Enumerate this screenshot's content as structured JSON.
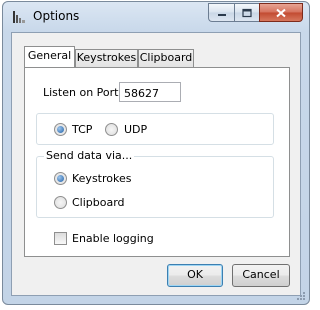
{
  "window": {
    "title": "Options",
    "controls": {
      "minimize": "minimize",
      "maximize": "maximize",
      "close": "close"
    }
  },
  "tabs": [
    {
      "label": "General",
      "active": true
    },
    {
      "label": "Keystrokes",
      "active": false
    },
    {
      "label": "Clipboard",
      "active": false
    }
  ],
  "general": {
    "port_label": "Listen on Port:",
    "port_value": "58627",
    "protocol": {
      "options": [
        "TCP",
        "UDP"
      ],
      "selected": "TCP"
    },
    "send_group": {
      "label": "Send data via...",
      "options": [
        "Keystrokes",
        "Clipboard"
      ],
      "selected": "Keystrokes"
    },
    "logging": {
      "label": "Enable logging",
      "checked": false
    }
  },
  "buttons": {
    "ok": "OK",
    "cancel": "Cancel"
  },
  "colors": {
    "titlebar": "#c8d8ea",
    "close": "#c24a30",
    "accent": "#2060a8"
  }
}
